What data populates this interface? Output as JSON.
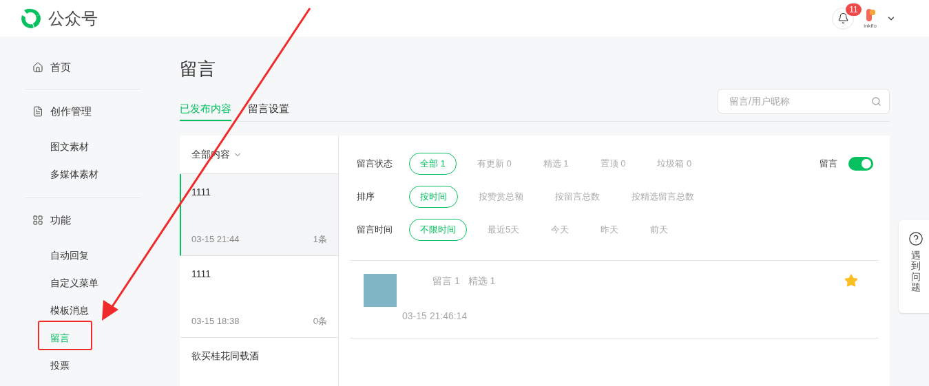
{
  "header": {
    "title": "公众号",
    "notifications": "11",
    "account_logo_text": "inkflo"
  },
  "sidebar": {
    "sections": [
      {
        "label": "首页"
      },
      {
        "label": "创作管理",
        "children": [
          {
            "label": "图文素材",
            "selected": false
          },
          {
            "label": "多媒体素材",
            "selected": false
          }
        ]
      },
      {
        "label": "功能",
        "children": [
          {
            "label": "自动回复",
            "selected": false
          },
          {
            "label": "自定义菜单",
            "selected": false
          },
          {
            "label": "模板消息",
            "selected": false
          },
          {
            "label": "留言",
            "selected": true
          },
          {
            "label": "投票",
            "selected": false
          }
        ]
      }
    ]
  },
  "page": {
    "title": "留言",
    "tabs": [
      {
        "label": "已发布内容",
        "selected": true
      },
      {
        "label": "留言设置",
        "selected": false
      }
    ],
    "search": {
      "placeholder": "留言/用户昵称"
    }
  },
  "articles": {
    "filter": "全部内容",
    "items": [
      {
        "title": "1111",
        "date": "03-15 21:44",
        "count": "1条",
        "selected": true
      },
      {
        "title": "1111",
        "date": "03-15 18:38",
        "count": "0条",
        "selected": false
      },
      {
        "title": "欲买桂花同载酒",
        "selected": false
      }
    ]
  },
  "filters": [
    {
      "label": "留言状态",
      "options": [
        {
          "label": "全部 1",
          "selected": true
        },
        {
          "label": "有更新 0",
          "selected": false
        },
        {
          "label": "精选 1",
          "selected": false
        },
        {
          "label": "置顶 0",
          "selected": false
        },
        {
          "label": "垃圾箱 0",
          "selected": false
        }
      ]
    },
    {
      "label": "排序",
      "options": [
        {
          "label": "按时间",
          "selected": true
        },
        {
          "label": "按赞赏总额",
          "selected": false
        },
        {
          "label": "按留言总数",
          "selected": false
        },
        {
          "label": "按精选留言总数",
          "selected": false
        }
      ]
    },
    {
      "label": "留言时间",
      "options": [
        {
          "label": "不限时间",
          "selected": true
        },
        {
          "label": "最近5天",
          "selected": false
        },
        {
          "label": "今天",
          "selected": false
        },
        {
          "label": "昨天",
          "selected": false
        },
        {
          "label": "前天",
          "selected": false
        }
      ]
    }
  ],
  "comment_toggle": {
    "label": "留言",
    "on": true
  },
  "comments": [
    {
      "stats": [
        "留言 1",
        "精选 1"
      ],
      "time": "03-15 21:46:14",
      "starred": true
    }
  ],
  "help": {
    "label": "遇到问题"
  }
}
